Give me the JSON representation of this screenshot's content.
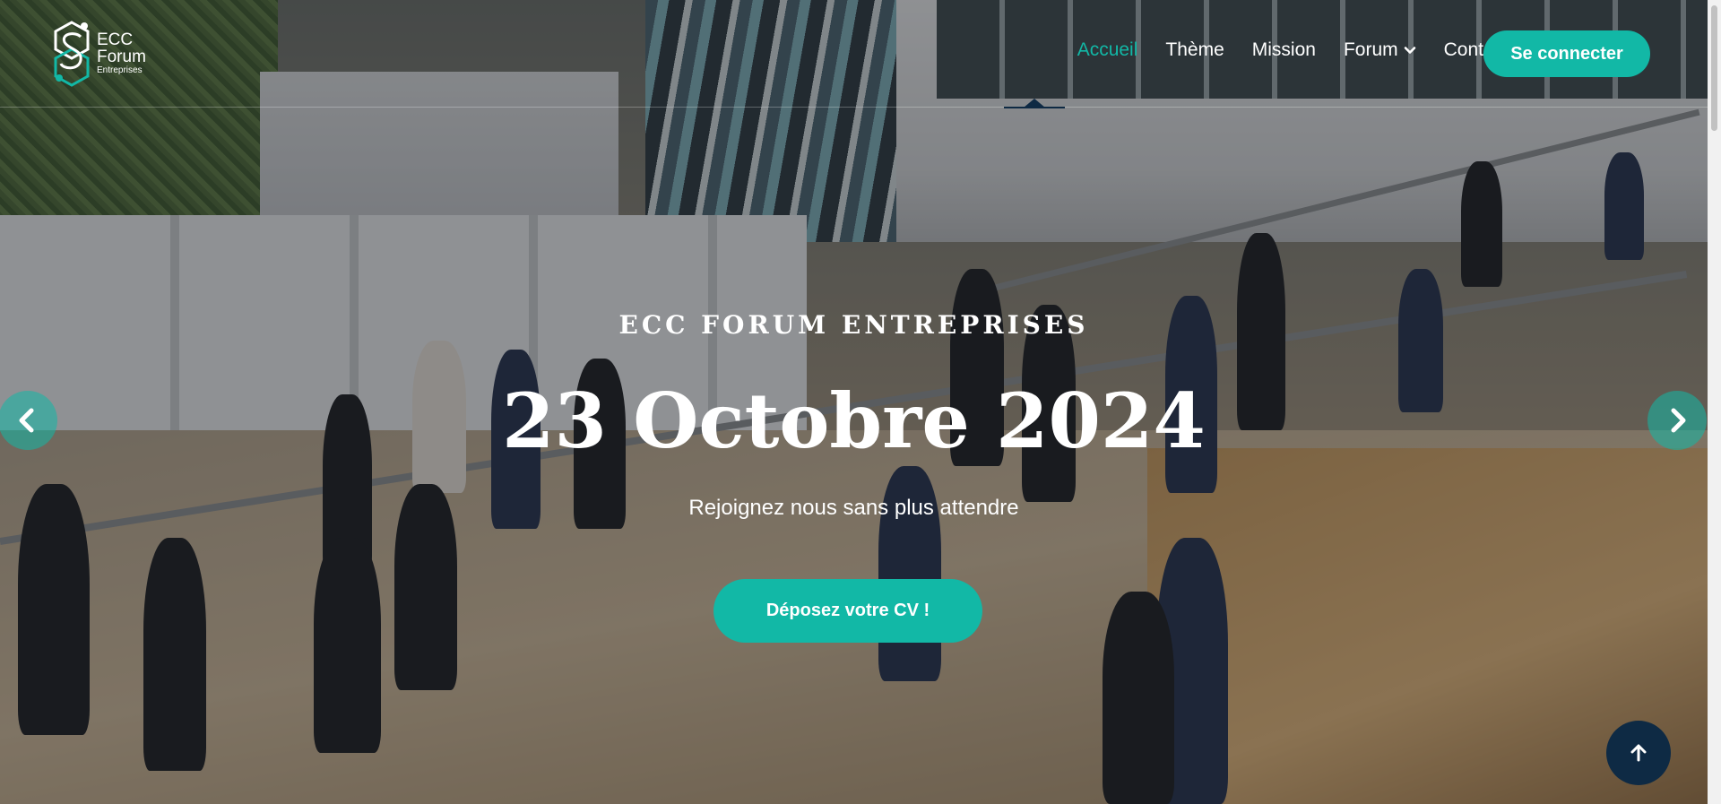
{
  "brand": {
    "logo_line1": "ECC",
    "logo_line2": "Forum",
    "logo_line3": "Entreprises",
    "accent_color": "#12b8a6",
    "dark_color": "#0e2a44"
  },
  "nav": {
    "items": [
      {
        "label": "Accueil",
        "active": true
      },
      {
        "label": "Thème",
        "active": false
      },
      {
        "label": "Mission",
        "active": false
      },
      {
        "label": "Forum",
        "active": false,
        "has_dropdown": true
      },
      {
        "label": "Contact",
        "active": false
      }
    ],
    "login_label": "Se connecter",
    "dropdown_icon": "chevron-down-icon"
  },
  "hero": {
    "kicker": "ECC FORUM ENTREPRISES",
    "title": "23 Octobre 2024",
    "subtitle": "Rejoignez nous sans plus attendre",
    "cta_label": "Déposez votre CV !"
  },
  "carousel": {
    "prev_icon": "chevron-left-icon",
    "next_icon": "chevron-right-icon"
  },
  "back_to_top_icon": "arrow-up-icon"
}
